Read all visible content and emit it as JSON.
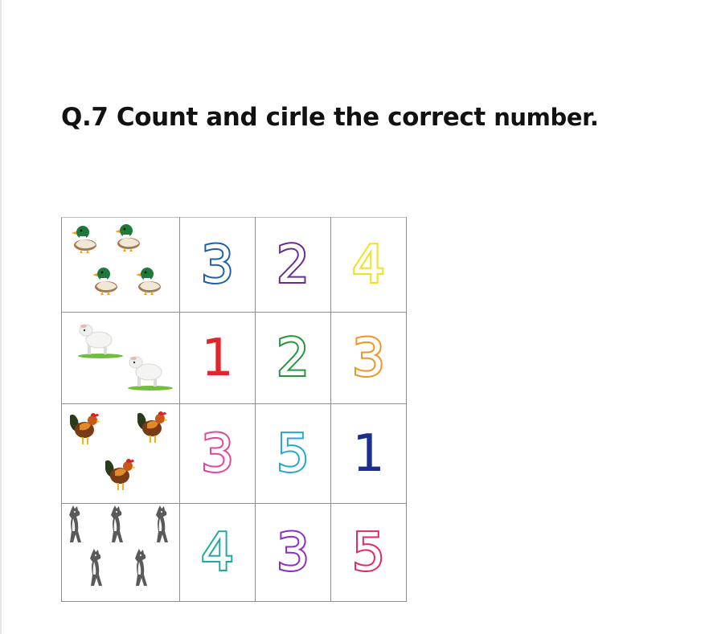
{
  "question": {
    "prefix": "Q.7 Count and cirle the correct",
    "last_word": "number."
  },
  "rows": [
    {
      "animal_icon": "duck-icon",
      "count_shown": 4,
      "options": [
        {
          "label": "3",
          "color": "#1f5fa8"
        },
        {
          "label": "2",
          "color": "#6a2c91"
        },
        {
          "label": "4",
          "color": "#f2e21b"
        }
      ]
    },
    {
      "animal_icon": "sheep-icon",
      "count_shown": 2,
      "options": [
        {
          "label": "1",
          "color": "#e0252d"
        },
        {
          "label": "2",
          "color": "#1f9a3a"
        },
        {
          "label": "3",
          "color": "#f39323"
        }
      ]
    },
    {
      "animal_icon": "rooster-icon",
      "count_shown": 3,
      "options": [
        {
          "label": "3",
          "color": "#e3459a"
        },
        {
          "label": "5",
          "color": "#25a6d9"
        },
        {
          "label": "1",
          "color": "#1a2f8f"
        }
      ]
    },
    {
      "animal_icon": "dog-icon",
      "count_shown": 5,
      "options": [
        {
          "label": "4",
          "color": "#1faa9c"
        },
        {
          "label": "3",
          "color": "#8a2ec8"
        },
        {
          "label": "5",
          "color": "#e3266a"
        }
      ]
    }
  ]
}
